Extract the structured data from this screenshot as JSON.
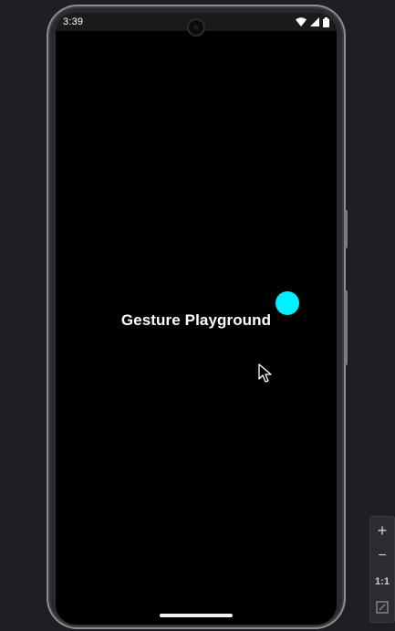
{
  "status_bar": {
    "time": "3:39",
    "icons": [
      "wifi-icon",
      "signal-icon",
      "battery-icon"
    ]
  },
  "app": {
    "title": "Gesture Playground",
    "ball_color": "#00f0ff",
    "background_color": "#000000"
  },
  "emulator_controls": {
    "zoom_in": "+",
    "zoom_out": "−",
    "actual_size": "1:1",
    "fit_icon": "fit-screen-icon"
  }
}
